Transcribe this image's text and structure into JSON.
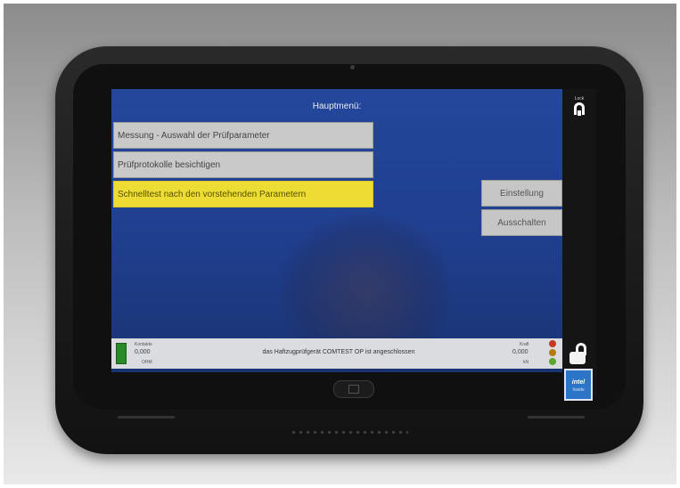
{
  "screen": {
    "title": "Hauptmenü:",
    "menu": [
      {
        "label": "Messung - Auswahl der Prüfparameter",
        "active": false
      },
      {
        "label": "Prüfprotokolle besichtigen",
        "active": false
      },
      {
        "label": "Schnelltest nach den vorstehenden Parametern",
        "active": true
      }
    ],
    "side_buttons": [
      {
        "label": "Einstellung"
      },
      {
        "label": "Ausschalten"
      }
    ],
    "status": {
      "left_label": "Kontakte",
      "left_value": "0,000",
      "left_unit": "OHM",
      "message": "das Haftzugprüfgerät COMTEST OP ist angeschlossen",
      "right_label": "Kraft",
      "right_value": "0,000",
      "right_unit": "kN"
    }
  },
  "sidebar": {
    "lock_label": "Lock",
    "badge_label": "intel",
    "badge_sub": "Inside"
  },
  "colors": {
    "screen_bg": "#1f3f8f",
    "button_gray": "#c9c9c9",
    "button_active": "#ecdc33",
    "led_red": "#c8381e",
    "led_amber": "#b87a10",
    "led_green": "#5aa826"
  }
}
